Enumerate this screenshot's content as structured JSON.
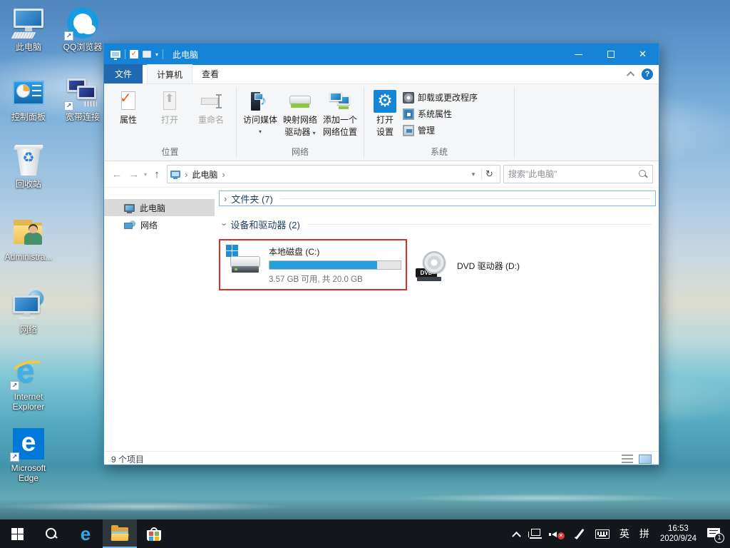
{
  "desktop": {
    "icons": [
      {
        "label": "此电脑"
      },
      {
        "label": "QQ浏览器"
      },
      {
        "label": "控制面板"
      },
      {
        "label": "宽带连接"
      },
      {
        "label": "回收站"
      },
      {
        "label": "Administra..."
      },
      {
        "label": "网络"
      },
      {
        "label": "Internet Explorer"
      },
      {
        "label": "Microsoft Edge"
      }
    ]
  },
  "window": {
    "title": "此电脑",
    "tabs": {
      "file": "文件",
      "computer": "计算机",
      "view": "查看"
    },
    "ribbon": {
      "properties": "属性",
      "open": "打开",
      "rename": "重命名",
      "access_media": "访问媒体",
      "map_drive_line1": "映射网络",
      "map_drive_line2": "驱动器",
      "add_location_line1": "添加一个",
      "add_location_line2": "网络位置",
      "open_settings_line1": "打开",
      "open_settings_line2": "设置",
      "uninstall": "卸载或更改程序",
      "system_properties": "系统属性",
      "manage": "管理",
      "group_location": "位置",
      "group_network": "网络",
      "group_system": "系统"
    },
    "address": {
      "breadcrumb": "此电脑",
      "search_placeholder": "搜索\"此电脑\""
    },
    "nav": {
      "this_pc": "此电脑",
      "network": "网络"
    },
    "content": {
      "folders_group": "文件夹 (7)",
      "devices_group": "设备和驱动器 (2)",
      "drive_c": {
        "name": "本地磁盘 (C:)",
        "usage": "3.57 GB 可用, 共 20.0 GB",
        "percent": 82
      },
      "drive_d": {
        "name": "DVD 驱动器 (D:)"
      }
    },
    "status": {
      "items": "9 个项目"
    }
  },
  "taskbar": {
    "ime_en": "英",
    "ime_pinyin": "拼",
    "time": "16:53",
    "date": "2020/9/24",
    "notification_badge": "1"
  },
  "colors": {
    "titlebar": "#1583d6",
    "accent_fill": "#26a0da",
    "highlight_red": "#e02a25"
  }
}
